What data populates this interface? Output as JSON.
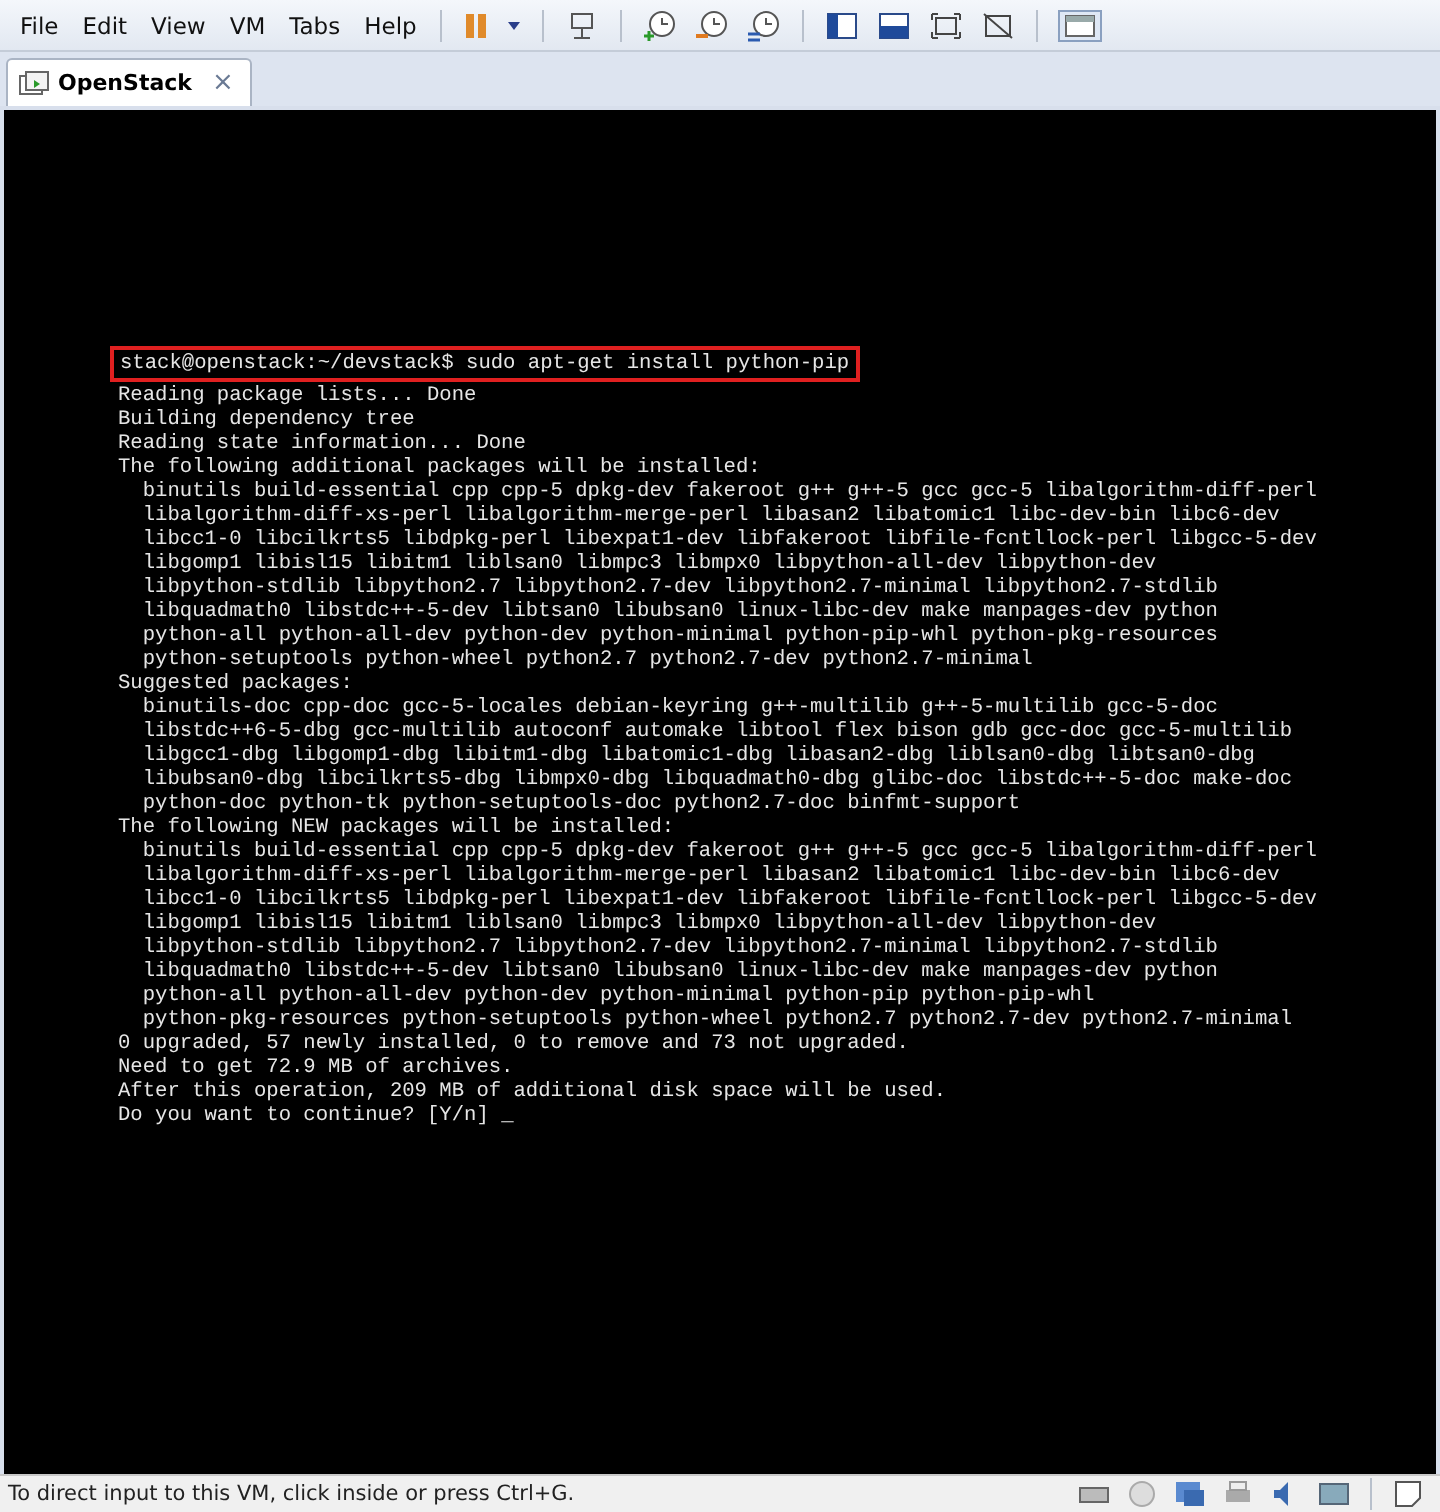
{
  "menu": [
    "File",
    "Edit",
    "View",
    "VM",
    "Tabs",
    "Help"
  ],
  "tabs": [
    {
      "label": "OpenStack",
      "selected": true,
      "close": "×"
    }
  ],
  "terminal": {
    "command": {
      "text": "stack@openstack:~/devstack$ sudo apt-get install python-pip",
      "highlighted": true
    },
    "lines": [
      "Reading package lists... Done",
      "Building dependency tree",
      "Reading state information... Done",
      "The following additional packages will be installed:",
      "  binutils build-essential cpp cpp-5 dpkg-dev fakeroot g++ g++-5 gcc gcc-5 libalgorithm-diff-perl",
      "  libalgorithm-diff-xs-perl libalgorithm-merge-perl libasan2 libatomic1 libc-dev-bin libc6-dev",
      "  libcc1-0 libcilkrts5 libdpkg-perl libexpat1-dev libfakeroot libfile-fcntllock-perl libgcc-5-dev",
      "  libgomp1 libisl15 libitm1 liblsan0 libmpc3 libmpx0 libpython-all-dev libpython-dev",
      "  libpython-stdlib libpython2.7 libpython2.7-dev libpython2.7-minimal libpython2.7-stdlib",
      "  libquadmath0 libstdc++-5-dev libtsan0 libubsan0 linux-libc-dev make manpages-dev python",
      "  python-all python-all-dev python-dev python-minimal python-pip-whl python-pkg-resources",
      "  python-setuptools python-wheel python2.7 python2.7-dev python2.7-minimal",
      "Suggested packages:",
      "  binutils-doc cpp-doc gcc-5-locales debian-keyring g++-multilib g++-5-multilib gcc-5-doc",
      "  libstdc++6-5-dbg gcc-multilib autoconf automake libtool flex bison gdb gcc-doc gcc-5-multilib",
      "  libgcc1-dbg libgomp1-dbg libitm1-dbg libatomic1-dbg libasan2-dbg liblsan0-dbg libtsan0-dbg",
      "  libubsan0-dbg libcilkrts5-dbg libmpx0-dbg libquadmath0-dbg glibc-doc libstdc++-5-doc make-doc",
      "  python-doc python-tk python-setuptools-doc python2.7-doc binfmt-support",
      "The following NEW packages will be installed:",
      "  binutils build-essential cpp cpp-5 dpkg-dev fakeroot g++ g++-5 gcc gcc-5 libalgorithm-diff-perl",
      "  libalgorithm-diff-xs-perl libalgorithm-merge-perl libasan2 libatomic1 libc-dev-bin libc6-dev",
      "  libcc1-0 libcilkrts5 libdpkg-perl libexpat1-dev libfakeroot libfile-fcntllock-perl libgcc-5-dev",
      "  libgomp1 libisl15 libitm1 liblsan0 libmpc3 libmpx0 libpython-all-dev libpython-dev",
      "  libpython-stdlib libpython2.7 libpython2.7-dev libpython2.7-minimal libpython2.7-stdlib",
      "  libquadmath0 libstdc++-5-dev libtsan0 libubsan0 linux-libc-dev make manpages-dev python",
      "  python-all python-all-dev python-dev python-minimal python-pip python-pip-whl",
      "  python-pkg-resources python-setuptools python-wheel python2.7 python2.7-dev python2.7-minimal",
      "0 upgraded, 57 newly installed, 0 to remove and 73 not upgraded.",
      "Need to get 72.9 MB of archives.",
      "After this operation, 209 MB of additional disk space will be used."
    ],
    "prompt": "Do you want to continue? [Y/n]",
    "cursor": "_"
  },
  "status_bar": {
    "message": "To direct input to this VM, click inside or press Ctrl+G."
  }
}
